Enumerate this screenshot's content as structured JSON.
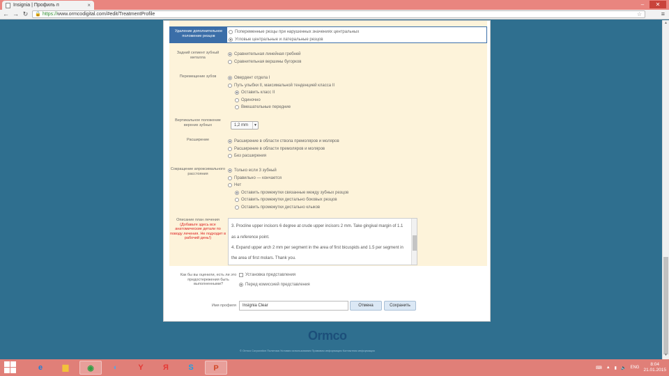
{
  "browser": {
    "tab_title": "Insignia | Профиль п",
    "url_scheme": "https://",
    "url_host": "www.ormcodigital.com",
    "url_path": "/#edit/TreatmentProfile",
    "minimize": "–",
    "close": "✕"
  },
  "form": {
    "rows": [
      {
        "label": "Удаление дополнительное положение резцов",
        "options": [
          {
            "text": "Попеременные резцы при нарушенных значениях центральных",
            "on": false
          },
          {
            "text": "Угловые центральные и латеральные резцов",
            "on": true
          }
        ]
      },
      {
        "label": "Задний сегмент зубный металла",
        "options": [
          {
            "text": "Сравнительная линейная гребней",
            "on": true
          },
          {
            "text": "Сравнительная вершины бугорков",
            "on": false
          }
        ]
      },
      {
        "label": "Перемещение зубов",
        "options": [
          {
            "text": "Овердент отдела I",
            "on": true
          },
          {
            "text": "Путь улыбки II, максимальной тенденцией класса II",
            "on": false
          }
        ],
        "suboptions": [
          {
            "text": "Оставить класс II",
            "on": true
          },
          {
            "text": "Одиночно",
            "on": false
          },
          {
            "text": "Вмешательные передние",
            "on": false
          }
        ]
      },
      {
        "label": "Вертикальное положение верхних зубных",
        "select_value": "1,2 mm"
      },
      {
        "label": "Расширение",
        "options": [
          {
            "text": "Расширение в области ствола премоляров и моляров",
            "on": true
          },
          {
            "text": "Расширение в области премоляров и моляров",
            "on": false
          },
          {
            "text": "Без расширения",
            "on": false
          }
        ]
      },
      {
        "label": "Сокращение апроксимального расстояния",
        "options": [
          {
            "text": "Только если 3 зубный",
            "on": true
          },
          {
            "text": "Правильно — кончается",
            "on": false
          },
          {
            "text": "Нет",
            "on": false
          }
        ],
        "suboptions": [
          {
            "text": "Оставить промежутки связанные между зубных резцов",
            "on": true
          },
          {
            "text": "Оставить промежутки дистально боковых резцов",
            "on": false
          },
          {
            "text": "Оставить промежутки дистально клыков",
            "on": false
          }
        ]
      }
    ],
    "notes": {
      "label": "Описание план лечения",
      "warning": "(Добавьте здесь все анатомические детали по поводу лечения. Не подходит в рабочий день!)",
      "lines": [
        "3. Procline upper incisors 6 degree at crude upper incisors 2 mm. Take gingival margin of 1.1",
        "as a reference point.",
        "4. Expand upper arch 2 mm per segment in the area of first bicuspids and 1.5 per segment in",
        "the area of first molars. Thank you."
      ]
    }
  },
  "bottom": {
    "question": "Как бы вы оценили, есть ли это предостережения быть выполненными?",
    "opt1": "Установка представления",
    "opt2": "Перед комиссией представления",
    "name_label": "Имя профиля",
    "name_value": "Insignia Clear",
    "cancel_label": "Отмена",
    "save_label": "Сохранить"
  },
  "footer": {
    "logo": "Ormco",
    "links": "© Ormco Corporation   Политика   Условия использования   Правовая информация   Контактная информация"
  },
  "taskbar": {
    "lang": "ENG",
    "time": "8:04",
    "date": "21.01.2015"
  },
  "colors": {
    "accent": "#3b6ea8",
    "form_bg": "#fdf3da",
    "page_bg": "#2f6f8f",
    "warning": "#dd2222"
  }
}
